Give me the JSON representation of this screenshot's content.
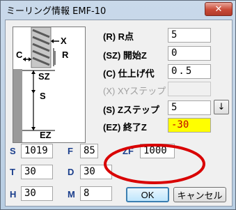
{
  "window": {
    "title": "ミーリング情報 EMF-10",
    "close_label": "✕"
  },
  "diagram": {
    "labels": {
      "x": "X",
      "r": "R",
      "c": "C",
      "sz": "SZ",
      "s": "S",
      "ez": "EZ"
    }
  },
  "params": [
    {
      "label": "(R) R点",
      "value": "5",
      "enabled": true
    },
    {
      "label": "(SZ) 開始Z",
      "value": "0",
      "enabled": true
    },
    {
      "label": "(C) 仕上げ代",
      "value": "0.5",
      "enabled": true
    },
    {
      "label": "(X) XYステップ",
      "value": "",
      "enabled": false
    },
    {
      "label": "(S) Zステップ",
      "value": "5",
      "enabled": true,
      "has_button": true,
      "button_label": "↓"
    },
    {
      "label": "(EZ) 終了Z",
      "value": "-30",
      "enabled": true,
      "highlight": "#ffff00"
    }
  ],
  "speeds": {
    "s": {
      "label": "S",
      "value": "1019"
    },
    "f": {
      "label": "F",
      "value": "85"
    },
    "zf": {
      "label": "ZF",
      "value": "1000"
    },
    "t": {
      "label": "T",
      "value": "30"
    },
    "d": {
      "label": "D",
      "value": "30"
    },
    "h": {
      "label": "H",
      "value": "30"
    },
    "m": {
      "label": "M",
      "value": "8"
    }
  },
  "buttons": {
    "ok": "OK",
    "cancel": "キャンセル"
  },
  "colors": {
    "accent": "#1a3e8c",
    "annotation": "#d90000",
    "highlight": "#ffff00"
  }
}
